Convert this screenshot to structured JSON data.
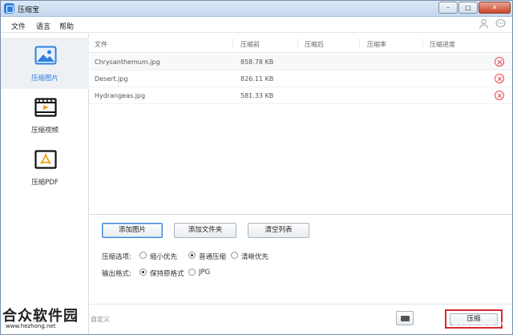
{
  "window": {
    "title": "压缩宝",
    "controls": [
      "–",
      "□",
      "✕"
    ]
  },
  "menu": [
    "文件",
    "语言",
    "帮助"
  ],
  "top_icons": [
    "user-icon",
    "chat-icon"
  ],
  "sidebar": {
    "items": [
      {
        "label": "压缩图片",
        "icon": "image-icon",
        "active": true
      },
      {
        "label": "压缩视频",
        "icon": "video-icon",
        "active": false
      },
      {
        "label": "压缩PDF",
        "icon": "pdf-icon",
        "active": false
      }
    ]
  },
  "table": {
    "headers": [
      "文件",
      "压缩前",
      "压缩后",
      "压缩率",
      "压缩进度"
    ],
    "rows": [
      {
        "name": "Chrysanthemum.jpg",
        "size": "858.78 KB"
      },
      {
        "name": "Desert.jpg",
        "size": "826.11 KB"
      },
      {
        "name": "Hydrangeas.jpg",
        "size": "581.33 KB"
      }
    ]
  },
  "actions": {
    "add_images": "添加图片",
    "add_folder": "添加文件夹",
    "clear_list": "清空列表"
  },
  "options": {
    "compress_label": "压缩选项:",
    "compress_choices": [
      "缩小优先",
      "普通压缩",
      "清晰优先"
    ],
    "compress_selected": 1,
    "output_label": "输出格式:",
    "output_choices": [
      "保持原格式",
      "JPG"
    ],
    "output_selected": 0
  },
  "bottom": {
    "faded_left": "压缩",
    "faded_mid": "自定义",
    "compress_button": "压缩"
  },
  "watermark": {
    "brand": "合众软件园",
    "url": "www.hezhong.net",
    "right": "www.wmzhe.com"
  },
  "colors": {
    "accent": "#2f7fe0",
    "remove": "#e44444",
    "highlight_border": "#d9282f"
  }
}
